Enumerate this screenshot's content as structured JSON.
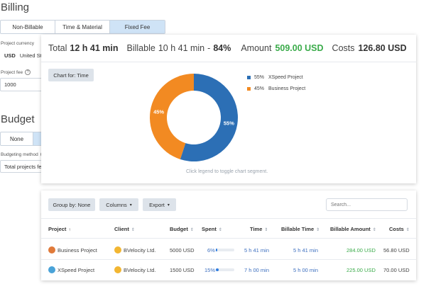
{
  "billing": {
    "title": "Billing",
    "tabs": [
      "Non-Billable",
      "Time & Material",
      "Fixed Fee"
    ],
    "active_tab": "Fixed Fee",
    "currency_label": "Project currency",
    "currency_code": "USD",
    "currency_name": "United St",
    "fee_label": "Project fee",
    "fee_value": "1000"
  },
  "budget": {
    "title": "Budget",
    "option_none": "None",
    "method_label": "Budgeting method",
    "method_value": "Total projects fe"
  },
  "summary": {
    "total_label": "Total",
    "total_value": "12 h 41 min",
    "billable_label": "Billable",
    "billable_value": "10 h 41 min",
    "billable_sep": "-",
    "billable_pct": "84%",
    "amount_label": "Amount",
    "amount_value": "509.00 USD",
    "costs_label": "Costs",
    "costs_value": "126.80 USD"
  },
  "chart_panel": {
    "chart_for_button": "Chart for: Time",
    "hint": "Click legend to toggle chart segment."
  },
  "chart_data": {
    "type": "pie",
    "donut": true,
    "series": [
      {
        "name": "XSpeed Project",
        "value": 55,
        "label": "55%",
        "legend_pct": "55%",
        "color": "#2c6fb5"
      },
      {
        "name": "Business Project",
        "value": 45,
        "label": "45%",
        "legend_pct": "45%",
        "color": "#f28a22"
      }
    ],
    "legend_placement": "right"
  },
  "toolbar": {
    "group_by": "Group by: None",
    "columns": "Columns",
    "export": "Export",
    "search_placeholder": "Search..."
  },
  "table": {
    "headers": {
      "project": "Project",
      "client": "Client",
      "budget": "Budget",
      "spent": "Spent",
      "time": "Time",
      "billable_time": "Billable Time",
      "billable_amount": "Billable Amount",
      "costs": "Costs"
    },
    "rows": [
      {
        "project": "Business Project",
        "client": "BVelocity Ltd.",
        "budget": "5000 USD",
        "spent": "6%",
        "spent_fraction": 0.06,
        "time": "5 h 41 min",
        "billable_time": "5 h 41 min",
        "billable_amount": "284.00 USD",
        "costs": "56.80 USD"
      },
      {
        "project": "XSpeed Project",
        "client": "BVelocity Ltd.",
        "budget": "1500 USD",
        "spent": "15%",
        "spent_fraction": 0.15,
        "time": "7 h 00 min",
        "billable_time": "5 h 00 min",
        "billable_amount": "225.00 USD",
        "costs": "70.00 USD"
      }
    ]
  }
}
